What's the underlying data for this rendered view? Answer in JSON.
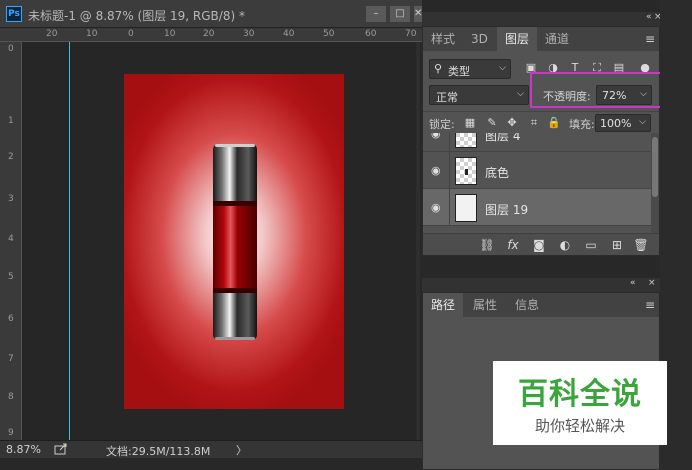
{
  "document": {
    "title": "未标题-1 @ 8.87% (图层 19, RGB/8) *",
    "app_logo": "Ps",
    "window_buttons": [
      "–",
      "□",
      "✕"
    ],
    "ruler_top_labels": [
      "20",
      "10",
      "0",
      "10",
      "20",
      "30",
      "40",
      "50",
      "60",
      "70"
    ],
    "ruler_left_labels": [
      "0",
      "1",
      "2",
      "3",
      "4",
      "5",
      "6",
      "7",
      "8",
      "9"
    ],
    "status": {
      "zoom": "8.87%",
      "info": "文档:29.5M/113.8M",
      "arrow": "〉"
    }
  },
  "layers_panel": {
    "tabs": [
      "样式",
      "3D",
      "图层",
      "通道"
    ],
    "active_tab": "图层",
    "filter": {
      "label": "类型",
      "icon": "search-icon"
    },
    "blend_mode": "正常",
    "opacity_label": "不透明度:",
    "opacity_value": "72%",
    "lock_label": "锁定:",
    "fill_label": "填充:",
    "fill_value": "100%",
    "layers": [
      {
        "name": "图层 4",
        "selected": false
      },
      {
        "name": "底色",
        "selected": false
      },
      {
        "name": "图层 19",
        "selected": true
      }
    ]
  },
  "paths_panel": {
    "tabs": [
      "路径",
      "属性",
      "信息"
    ],
    "active_tab": "路径"
  },
  "watermark": {
    "title": "百科全说",
    "subtitle": "助你轻松解决"
  },
  "colors": {
    "highlight": "#c838c8",
    "guide": "#3fc2d9",
    "canvas_red": "#b21416",
    "watermark_green": "#3aa53a"
  }
}
